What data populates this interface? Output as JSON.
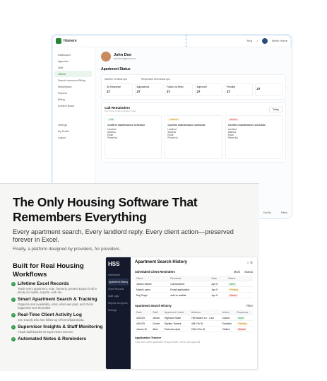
{
  "back": {
    "brand": "Homere",
    "top_right": [
      "Req",
      "Berlin Home"
    ],
    "sidebar": [
      "Dashboard",
      "Agencies",
      "Staff",
      "Clients",
      "Search Insurance Billing",
      "Marketplace",
      "Reports",
      "Billing",
      "Incident Board",
      "Settings",
      "My Profile",
      "Logout"
    ],
    "profile": {
      "name": "John Doe",
      "email": "johndoe@gmail.com"
    },
    "status_title": "Apartment Status",
    "followups": [
      "Number of follow ups",
      "Responses from follow ups"
    ],
    "stats": [
      {
        "label": "No Response",
        "value": "27"
      },
      {
        "label": "Applications",
        "value": "27"
      },
      {
        "label": "Follow Up Need",
        "value": "27"
      },
      {
        "label": "Approved",
        "value": "27"
      },
      {
        "label": "Pending",
        "value": "27"
      },
      {
        "label": "",
        "value": "27"
      }
    ],
    "reminders_title": "Call Remainders",
    "reminders_sub": "Pay Home 3 call reminders Today",
    "today": "Today",
    "cards": [
      {
        "tag": "Call",
        "title": "Confirm maintenance schedule"
      },
      {
        "tag": "Callback",
        "title": "Confirm maintenance schedule"
      },
      {
        "tag": "Missed",
        "title": "Confirm maintenance schedule"
      }
    ],
    "card_fields": [
      "Landlord",
      "Address",
      "Email",
      "Phone No"
    ],
    "sort": "Sort By",
    "filters": "Filters"
  },
  "hero": {
    "title": "The Only Housing Software That Remembers Everything",
    "subtitle": "Every apartment search, Every landlord reply. Every client action—preserved forever in Excel.",
    "tagline": "Finally, a platform designed by providers, for providers."
  },
  "features": {
    "heading": "Built for Real Housing Workflows",
    "items": [
      {
        "title": "Lifetime Excel Records",
        "desc": "Track every apartment, note, formerly, present Export it all in plenty for audits, reports, and rule."
      },
      {
        "title": "Smart Apartment Search & Tracking",
        "desc": "Organize and availability, what, what was paid, and check happened next thereafter"
      },
      {
        "title": "Real-Time Client Activity Log",
        "desc": "See exactly who has follow-up of forms/dates/data."
      },
      {
        "title": "Supervisor Insights & Staff Monitoring",
        "desc": "Visual dashboards let supervisors oversee"
      },
      {
        "title": "Automated Notes & Reminders",
        "desc": ""
      }
    ]
  },
  "app": {
    "logo": "HSS",
    "nav": [
      "Dashboard",
      "Apartment History",
      "Client Records",
      "Staff Logs",
      "Reports & Exports",
      "Settings"
    ],
    "title": "Apartment Search History",
    "scheduled": {
      "title": "Scheduled Client Reminders",
      "actions": [
        "Mark",
        "Status"
      ],
      "headers": [
        "Client",
        "Reminder",
        "Date",
        "Status"
      ],
      "rows": [
        [
          "James Maher",
          "Call landlord",
          "Apr 5",
          "Done"
        ],
        [
          "Maria Lopez",
          "Email application",
          "Apr 5",
          "Pending"
        ],
        [
          "Raj Singh",
          "Add to waitlist",
          "Apr 5",
          "Missed"
        ]
      ]
    },
    "history": {
      "title": "Apartment Search History",
      "action": "Filter",
      "headers": [
        "Date",
        "Staff",
        "Apartment Listed",
        "Address",
        "Action",
        "Response"
      ],
      "rows": [
        [
          "4/02/25",
          "Jamal",
          "Highland Slate",
          "789 Main's Ln - Can",
          "Called",
          "Done"
        ],
        [
          "4/02/25",
          "Gloria",
          "Skyline Towers",
          "456 7th St",
          "Emailed",
          "Pending"
        ],
        [
          "James W",
          "Allen",
          "Parkview Apts",
          "230s Elm St",
          "Visited",
          "Missed"
        ]
      ]
    },
    "tracker": {
      "title": "Application Tracker",
      "sub": "Track each client application through intake, review, and approval"
    }
  }
}
